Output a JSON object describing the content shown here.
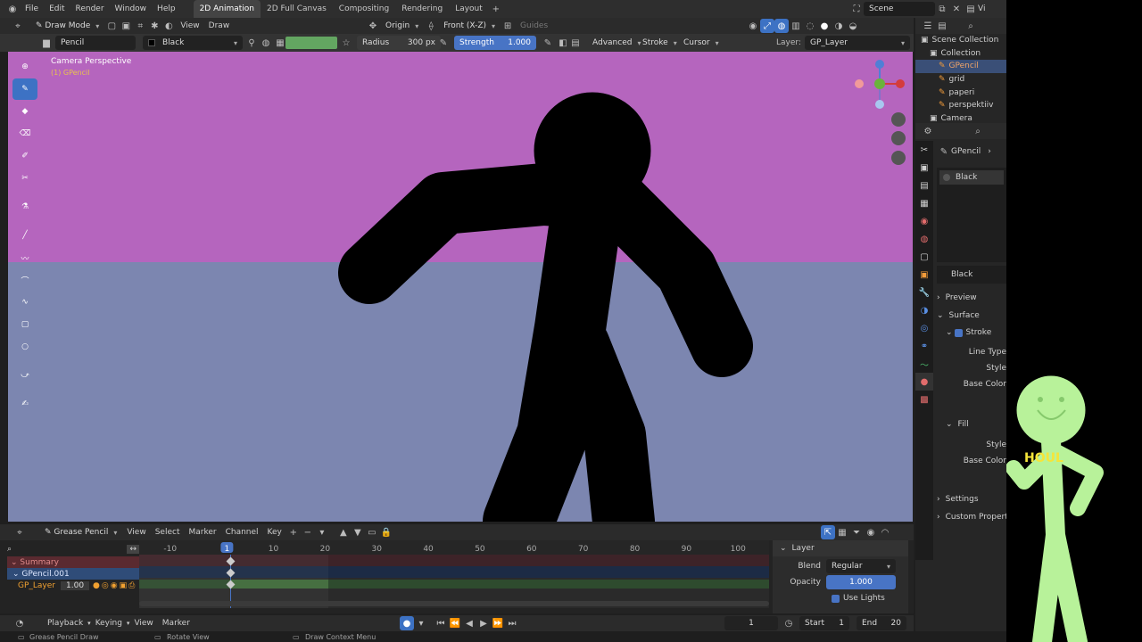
{
  "topbar": {
    "menus": [
      "File",
      "Edit",
      "Render",
      "Window",
      "Help"
    ],
    "workspaces": [
      "2D Animation",
      "2D Full Canvas",
      "Compositing",
      "Rendering",
      "Layout"
    ],
    "active_workspace": "2D Animation",
    "scene": "Scene",
    "view_layer_partial": "Vi"
  },
  "header": {
    "mode": "Draw Mode",
    "view": "View",
    "draw": "Draw",
    "origin": "Origin",
    "orientation": "Front (X-Z)",
    "guides": "Guides"
  },
  "toolsettings": {
    "brush": "Pencil",
    "material": "Black",
    "radius_label": "Radius",
    "radius_value": "300 px",
    "strength_label": "Strength",
    "strength_value": "1.000",
    "advanced": "Advanced",
    "stroke": "Stroke",
    "cursor": "Cursor",
    "layer_label": "Layer:",
    "layer_value": "GP_Layer"
  },
  "viewport": {
    "title": "Camera Perspective",
    "subtitle": "(1) GPencil",
    "sky_color": "#b565be",
    "ground_color": "#7c86b0"
  },
  "outliner": {
    "items": [
      {
        "label": "Scene Collection",
        "level": 0
      },
      {
        "label": "Collection",
        "level": 1
      },
      {
        "label": "GPencil",
        "level": 2,
        "selected": true
      },
      {
        "label": "grid",
        "level": 2
      },
      {
        "label": "paperi",
        "level": 2
      },
      {
        "label": "perspektiiv",
        "level": 2
      },
      {
        "label": "Camera",
        "level": 1
      }
    ]
  },
  "properties": {
    "object": "GPencil",
    "slot": "Black",
    "material": "Black",
    "sections": {
      "preview": "Preview",
      "surface": "Surface",
      "stroke": "Stroke",
      "line_type": "Line Type",
      "style": "Style",
      "base_color": "Base Color",
      "fill": "Fill",
      "fill_style": "Style",
      "fill_base_color": "Base Color",
      "settings": "Settings",
      "custom": "Custom Properti"
    }
  },
  "timeline": {
    "editor": "Grease Pencil",
    "menus": [
      "View",
      "Select",
      "Marker",
      "Channel",
      "Key"
    ],
    "ruler": [
      "-10",
      "1",
      "10",
      "20",
      "30",
      "40",
      "50",
      "60",
      "70",
      "80",
      "90",
      "100"
    ],
    "current_frame": "1",
    "channels": {
      "summary": "Summary",
      "object": "GPencil.001",
      "layer": "GP_Layer",
      "layer_opacity": "1.00"
    },
    "layer_panel": {
      "title": "Layer",
      "blend_label": "Blend",
      "blend_value": "Regular",
      "opacity_label": "Opacity",
      "opacity_value": "1.000",
      "use_lights": "Use Lights"
    }
  },
  "playback": {
    "menus": [
      "Playback",
      "Keying",
      "View",
      "Marker"
    ],
    "frame": "1",
    "start_label": "Start",
    "start_value": "1",
    "end_label": "End",
    "end_value": "20"
  },
  "status": {
    "left": "Grease Pencil Draw",
    "middle": "Rotate View",
    "right": "Draw Context Menu"
  },
  "overlay": {
    "badge_text": "HOUL"
  }
}
